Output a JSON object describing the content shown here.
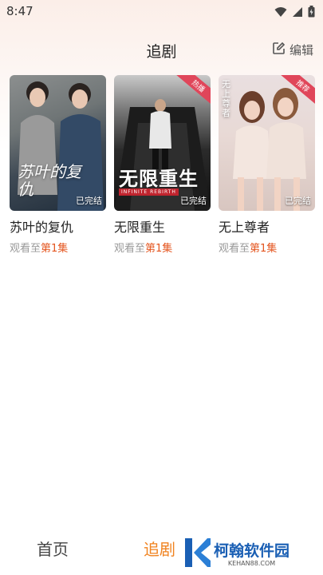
{
  "status_bar": {
    "time": "8:47"
  },
  "header": {
    "title": "追剧",
    "edit_label": "编辑"
  },
  "dramas": [
    {
      "title": "苏叶的复仇",
      "poster_text": "苏叶的复仇",
      "status": "已完结",
      "ribbon": "",
      "watch_prefix": "观看至",
      "watch_episode": "第1集"
    },
    {
      "title": "无限重生",
      "poster_text": "无限重生",
      "poster_subtext": "INFINITE REBIRTH",
      "status": "已完结",
      "ribbon": "热播",
      "watch_prefix": "观看至",
      "watch_episode": "第1集"
    },
    {
      "title": "无上尊者",
      "poster_text": "无上尊者",
      "status": "已完结",
      "ribbon": "推荐",
      "watch_prefix": "观看至",
      "watch_episode": "第1集"
    }
  ],
  "bottom_nav": {
    "home": "首页",
    "drama": "追剧"
  },
  "watermark": {
    "text": "柯翰软件园",
    "sub": "KEHAN88.COM"
  },
  "colors": {
    "accent": "#f0821e",
    "episode": "#e4551f"
  }
}
